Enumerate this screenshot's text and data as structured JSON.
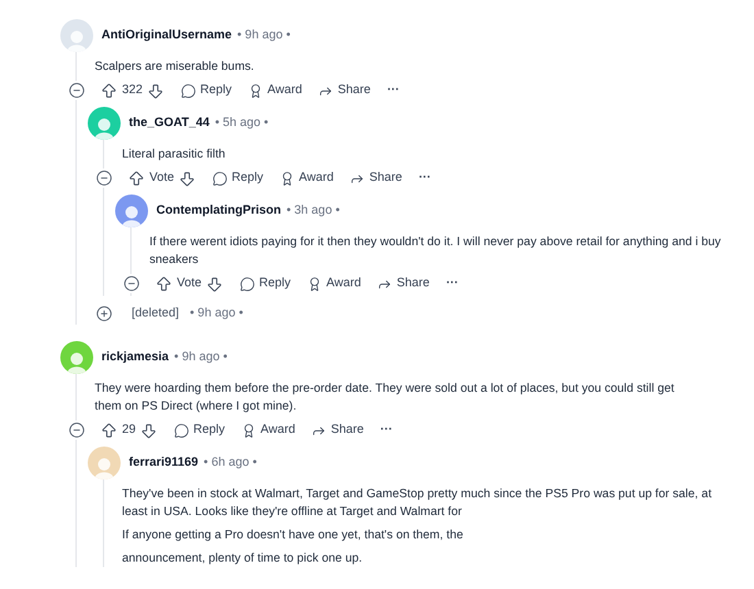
{
  "comments": [
    {
      "kind": "comment",
      "author": "AntiOriginalUsername",
      "time": "• 9h ago •",
      "color": "#dfe6ee",
      "paragraphs": [
        "Scalpers are miserable bums."
      ],
      "score": "322",
      "expanded": true,
      "actions": [
        "Reply",
        "Award",
        "Share"
      ],
      "more": "···",
      "children": [
        {
          "kind": "comment",
          "author": "the_GOAT_44",
          "time": "• 5h ago •",
          "color": "#1ccfa0",
          "paragraphs": [
            "Literal parasitic filth"
          ],
          "score": "Vote",
          "expanded": true,
          "actions": [
            "Reply",
            "Award",
            "Share"
          ],
          "more": "···",
          "children": [
            {
              "kind": "comment",
              "author": "ContemplatingPrison",
              "time": "• 3h ago •",
              "color": "#7c98f0",
              "paragraphs": [
                "If there werent idiots paying for it then they wouldn't do it. I will never pay above retail for anything and i buy sneakers"
              ],
              "score": "Vote",
              "expanded": true,
              "actions": [
                "Reply",
                "Award",
                "Share"
              ],
              "more": "···"
            }
          ]
        },
        {
          "kind": "deleted",
          "author": "[deleted]",
          "time": "• 9h ago •",
          "expanded": false
        }
      ]
    },
    {
      "kind": "comment",
      "author": "rickjamesia",
      "time": "• 9h ago •",
      "color": "#6fd63f",
      "paragraphs": [
        "They were hoarding them before the pre-order date. They were sold out a lot of places, but you could still get them on PS Direct (where I got mine)."
      ],
      "score": "29",
      "expanded": true,
      "actions": [
        "Reply",
        "Award",
        "Share"
      ],
      "more": "···",
      "children": [
        {
          "kind": "comment",
          "author": "ferrari91169",
          "time": "• 6h ago •",
          "color": "#f1d9b5",
          "paragraphs": [
            "They've been in stock at Walmart, Target and GameStop pretty much since the PS5 Pro was put up for sale, at least in USA. Looks like they're offline at Target and Walmart for",
            "If anyone getting a Pro doesn't have one yet, that's on them, the",
            "announcement, plenty of time to pick one up."
          ]
        }
      ]
    }
  ]
}
